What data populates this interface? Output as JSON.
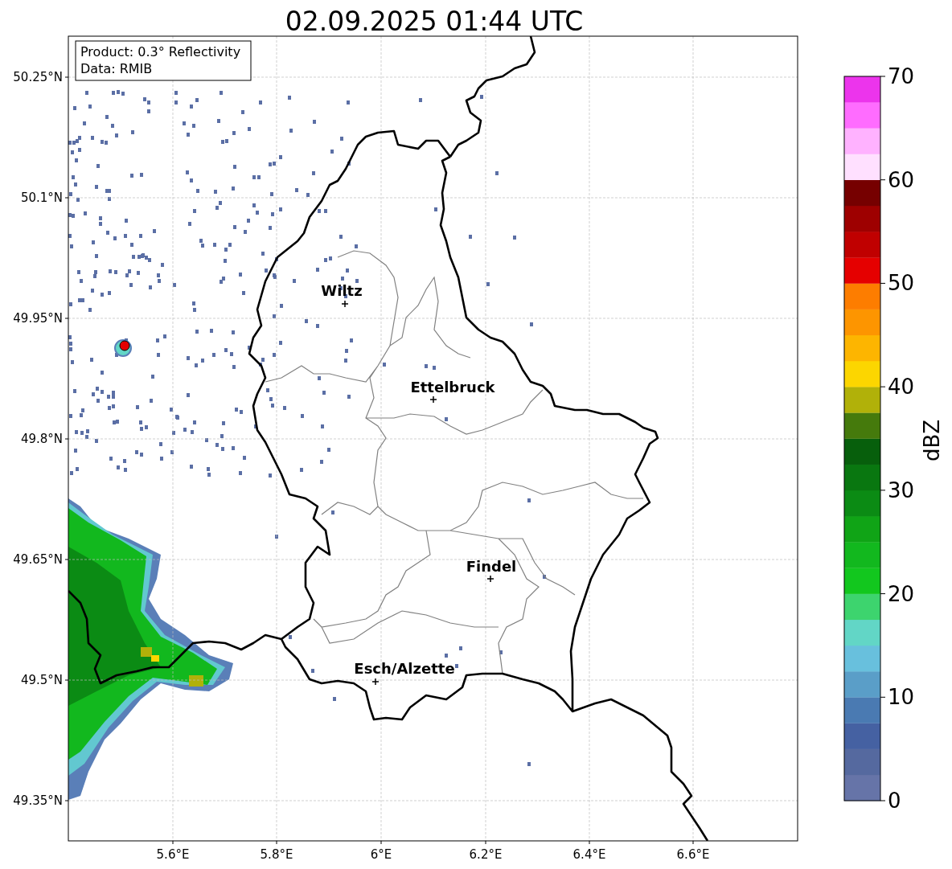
{
  "title": "02.09.2025 01:44 UTC",
  "legend": [
    "Product: 0.3° Reflectivity",
    "Data: RMIB"
  ],
  "y_ticks": [
    "50.25°N",
    "50.1°N",
    "49.95°N",
    "49.8°N",
    "49.65°N",
    "49.5°N",
    "49.35°N"
  ],
  "x_ticks": [
    "5.6°E",
    "5.8°E",
    "6°E",
    "6.2°E",
    "6.4°E",
    "6.6°E"
  ],
  "cities": [
    {
      "name": "Wiltz"
    },
    {
      "name": "Ettelbruck"
    },
    {
      "name": "Findel"
    },
    {
      "name": "Esch/Alzette"
    }
  ],
  "colorbar": {
    "label": "dBZ",
    "ticks": [
      "70",
      "60",
      "50",
      "40",
      "30",
      "20",
      "10",
      "0"
    ],
    "bins": [
      {
        "color": "#6674a8"
      },
      {
        "color": "#55699f"
      },
      {
        "color": "#4561a2"
      },
      {
        "color": "#4a7ab2"
      },
      {
        "color": "#5a9ec8"
      },
      {
        "color": "#68c0dd"
      },
      {
        "color": "#62d6c6"
      },
      {
        "color": "#3dd46e"
      },
      {
        "color": "#12c71e"
      },
      {
        "color": "#12b81e"
      },
      {
        "color": "#10a416"
      },
      {
        "color": "#0b8b14"
      },
      {
        "color": "#097710"
      },
      {
        "color": "#075f0c"
      },
      {
        "color": "#457a0c"
      },
      {
        "color": "#b1b109"
      },
      {
        "color": "#fcd600"
      },
      {
        "color": "#fdb500"
      },
      {
        "color": "#fd9500"
      },
      {
        "color": "#fd7d00"
      },
      {
        "color": "#e50000"
      },
      {
        "color": "#c00000"
      },
      {
        "color": "#9e0000"
      },
      {
        "color": "#760000"
      },
      {
        "color": "#ffe0ff"
      },
      {
        "color": "#ffb2ff"
      },
      {
        "color": "#ff6cff"
      },
      {
        "color": "#ec34ec"
      }
    ]
  }
}
